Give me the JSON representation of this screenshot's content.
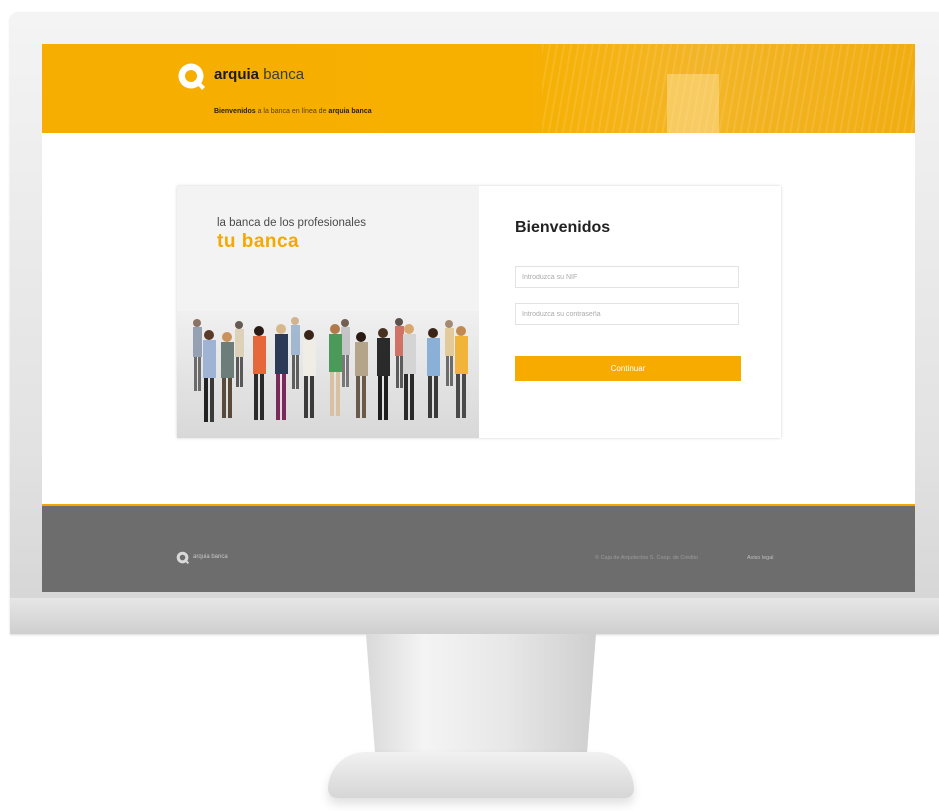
{
  "brand": {
    "name_bold": "arquia",
    "name_light": "banca",
    "accent_color": "#f7ab00",
    "logo_icon": "q-logo-icon"
  },
  "header": {
    "tagline_bold": "Bienvenidos",
    "tagline_middle": "a la banca en línea de",
    "tagline_brand": "arquia banca"
  },
  "promo": {
    "tagline": "la banca de los profesionales",
    "headline": "tu banca",
    "image": "crowd-of-people-image"
  },
  "login": {
    "title": "Bienvenidos",
    "user_placeholder": "Introduzca su NIF",
    "password_placeholder": "Introduzca su contraseña",
    "submit_label": "Continuar"
  },
  "footer": {
    "logo_text": "arquia banca",
    "legal": "© Caja de Arquitectos S. Coop. de Crédito",
    "link": "Aviso legal",
    "background_color": "#6d6d6d"
  }
}
